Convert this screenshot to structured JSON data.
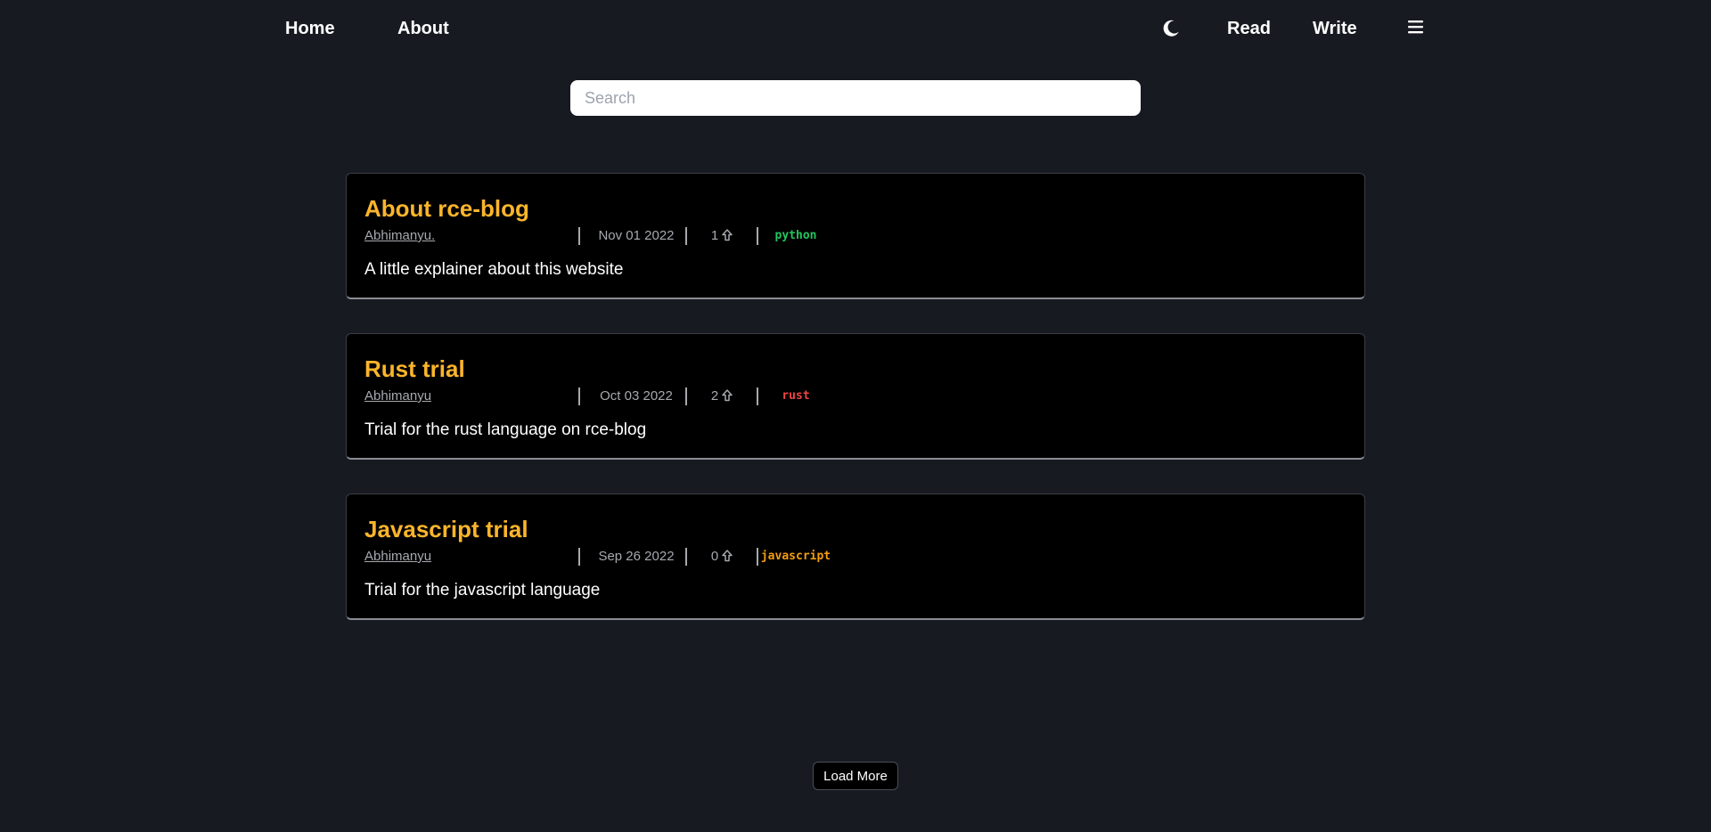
{
  "nav": {
    "home_label": "Home",
    "about_label": "About",
    "read_label": "Read",
    "write_label": "Write",
    "theme_icon": "moon-icon",
    "menu_icon": "hamburger-menu-icon"
  },
  "search": {
    "placeholder": "Search",
    "value": ""
  },
  "posts": [
    {
      "title": "About rce-blog",
      "author": "Abhimanyu.",
      "date": "Nov 01 2022",
      "votes": "1",
      "tag": "python",
      "tag_color": "#22c55e",
      "description": "A little explainer about this website"
    },
    {
      "title": "Rust trial",
      "author": "Abhimanyu",
      "date": "Oct 03 2022",
      "votes": "2",
      "tag": "rust",
      "tag_color": "#ef4444",
      "description": "Trial for the rust language on rce-blog"
    },
    {
      "title": "Javascript trial",
      "author": "Abhimanyu",
      "date": "Sep 26 2022",
      "votes": "0",
      "tag": "javascript",
      "tag_color": "#f59e0b",
      "description": "Trial for the javascript language"
    }
  ],
  "load_more_label": "Load More",
  "colors": {
    "background": "#171a21",
    "card_background": "#000000",
    "title_accent": "#fbb52b",
    "meta_text": "#a6a9ae"
  }
}
